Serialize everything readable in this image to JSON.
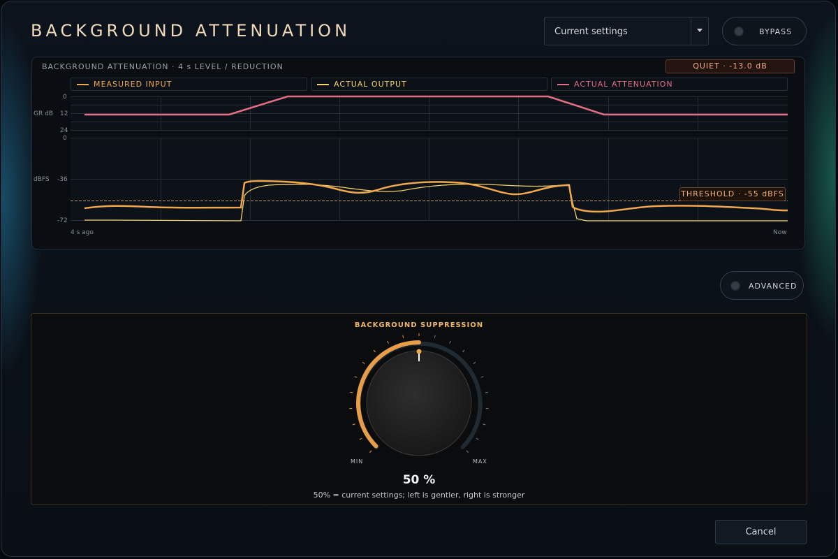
{
  "app": {
    "title": "BACKGROUND ATTENUATION"
  },
  "header": {
    "preset_value": "Current settings",
    "bypass_label": "BYPASS"
  },
  "graph": {
    "title": "BACKGROUND ATTENUATION · 4 s LEVEL / REDUCTION",
    "status_badge": "QUIET · -13.0 dB",
    "legend": [
      {
        "label": "MEASURED INPUT",
        "color": "#f0a84f"
      },
      {
        "label": "ACTUAL OUTPUT",
        "color": "#f5d36a"
      },
      {
        "label": "ACTUAL ATTENUATION",
        "color": "#e46e87"
      }
    ],
    "gr_axis": {
      "label": "GR dB",
      "ticks": [
        "0",
        "12",
        "24"
      ]
    },
    "level_axis": {
      "label": "dBFS",
      "ticks": [
        "0",
        "-36",
        "-72"
      ]
    },
    "time_start": "4 s ago",
    "time_end": "Now",
    "threshold_label": "THRESHOLD · -55 dBFS"
  },
  "advanced": {
    "label": "ADVANCED"
  },
  "suppression": {
    "title": "BACKGROUND SUPPRESSION",
    "min_label": "MIN",
    "max_label": "MAX",
    "value": 50,
    "value_text": "50 %",
    "hint": "50% = current settings; left is gentler, right is stronger"
  },
  "footer": {
    "cancel_label": "Cancel"
  },
  "colors": {
    "accent": "#f0a84f",
    "output": "#f5d36a",
    "attenuation": "#e46e87",
    "title": "#efd9b8"
  }
}
